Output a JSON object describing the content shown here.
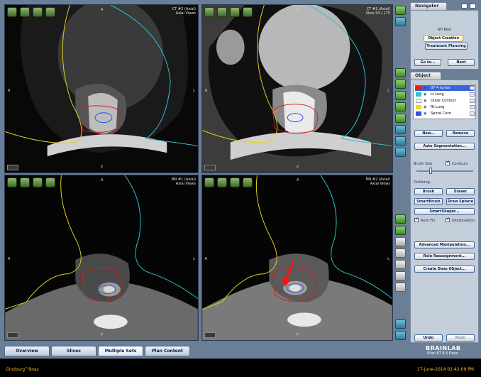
{
  "viewers": [
    {
      "id": "v1",
      "info": [
        "CT #2 (Axial)",
        "Axial Views"
      ],
      "top": "A",
      "left": "R",
      "right": "L",
      "bottom": "P",
      "modality": "ct-bone"
    },
    {
      "id": "v2",
      "info": [
        "CT #1 (Axial)",
        "Slice 93 / 175"
      ],
      "top": "A",
      "left": "R",
      "right": "L",
      "bottom": "P",
      "modality": "ct-soft"
    },
    {
      "id": "v3",
      "info": [
        "MR #1 (Axial)",
        "Axial Views"
      ],
      "top": "A",
      "left": "R",
      "right": "L",
      "bottom": "P",
      "modality": "mr"
    },
    {
      "id": "v4",
      "info": [
        "MR #2 (Axial)",
        "Axial Views"
      ],
      "top": "A",
      "left": "R",
      "right": "L",
      "bottom": "P",
      "modality": "mr"
    }
  ],
  "navigator": {
    "title": "Navigator",
    "subtitle": "RH Reel",
    "step1": "Object Creation",
    "step2": "Treatment Planning",
    "back": "Go to...",
    "next": "Next"
  },
  "object": {
    "title": "Object",
    "items": [
      {
        "name": "07-4 tumor",
        "color": "#e02020",
        "selected": true
      },
      {
        "name": "Lt Lung",
        "color": "#30c0d0",
        "selected": false
      },
      {
        "name": "Outer Contour",
        "color": "#ffffff",
        "selected": false
      },
      {
        "name": "Rt Lung",
        "color": "#e0e020",
        "selected": false
      },
      {
        "name": "Spinal Cord",
        "color": "#3050e0",
        "selected": false
      }
    ],
    "new": "New...",
    "remove": "Remove",
    "auto_seg": "Auto Segmentation...",
    "brush_size": "Brush Size",
    "contours": "Contours",
    "outlining": "Outlining",
    "brush": "Brush",
    "eraser": "Eraser",
    "smartbrush": "SmartBrush",
    "draw_sphere": "Draw Sphere",
    "smartshaper": "SmartShaper...",
    "auto_fill": "Auto Fill",
    "interpolation": "Interpolation",
    "adv_manip": "Advanced Manipulation...",
    "role_reassign": "Role Reassignment...",
    "create_dose": "Create Dose Object...",
    "undo": "Undo",
    "redo": "Redo"
  },
  "bottom_tabs": [
    "Overview",
    "Slices",
    "Multiple Sets",
    "Plan Content"
  ],
  "brand": {
    "name": "BRAINLAB",
    "product": "iPlan RT 4.5 Dose"
  },
  "status": {
    "user": "Ginzburg^Boaz",
    "datetime": "17-June-2014  02:42:09 PM"
  }
}
